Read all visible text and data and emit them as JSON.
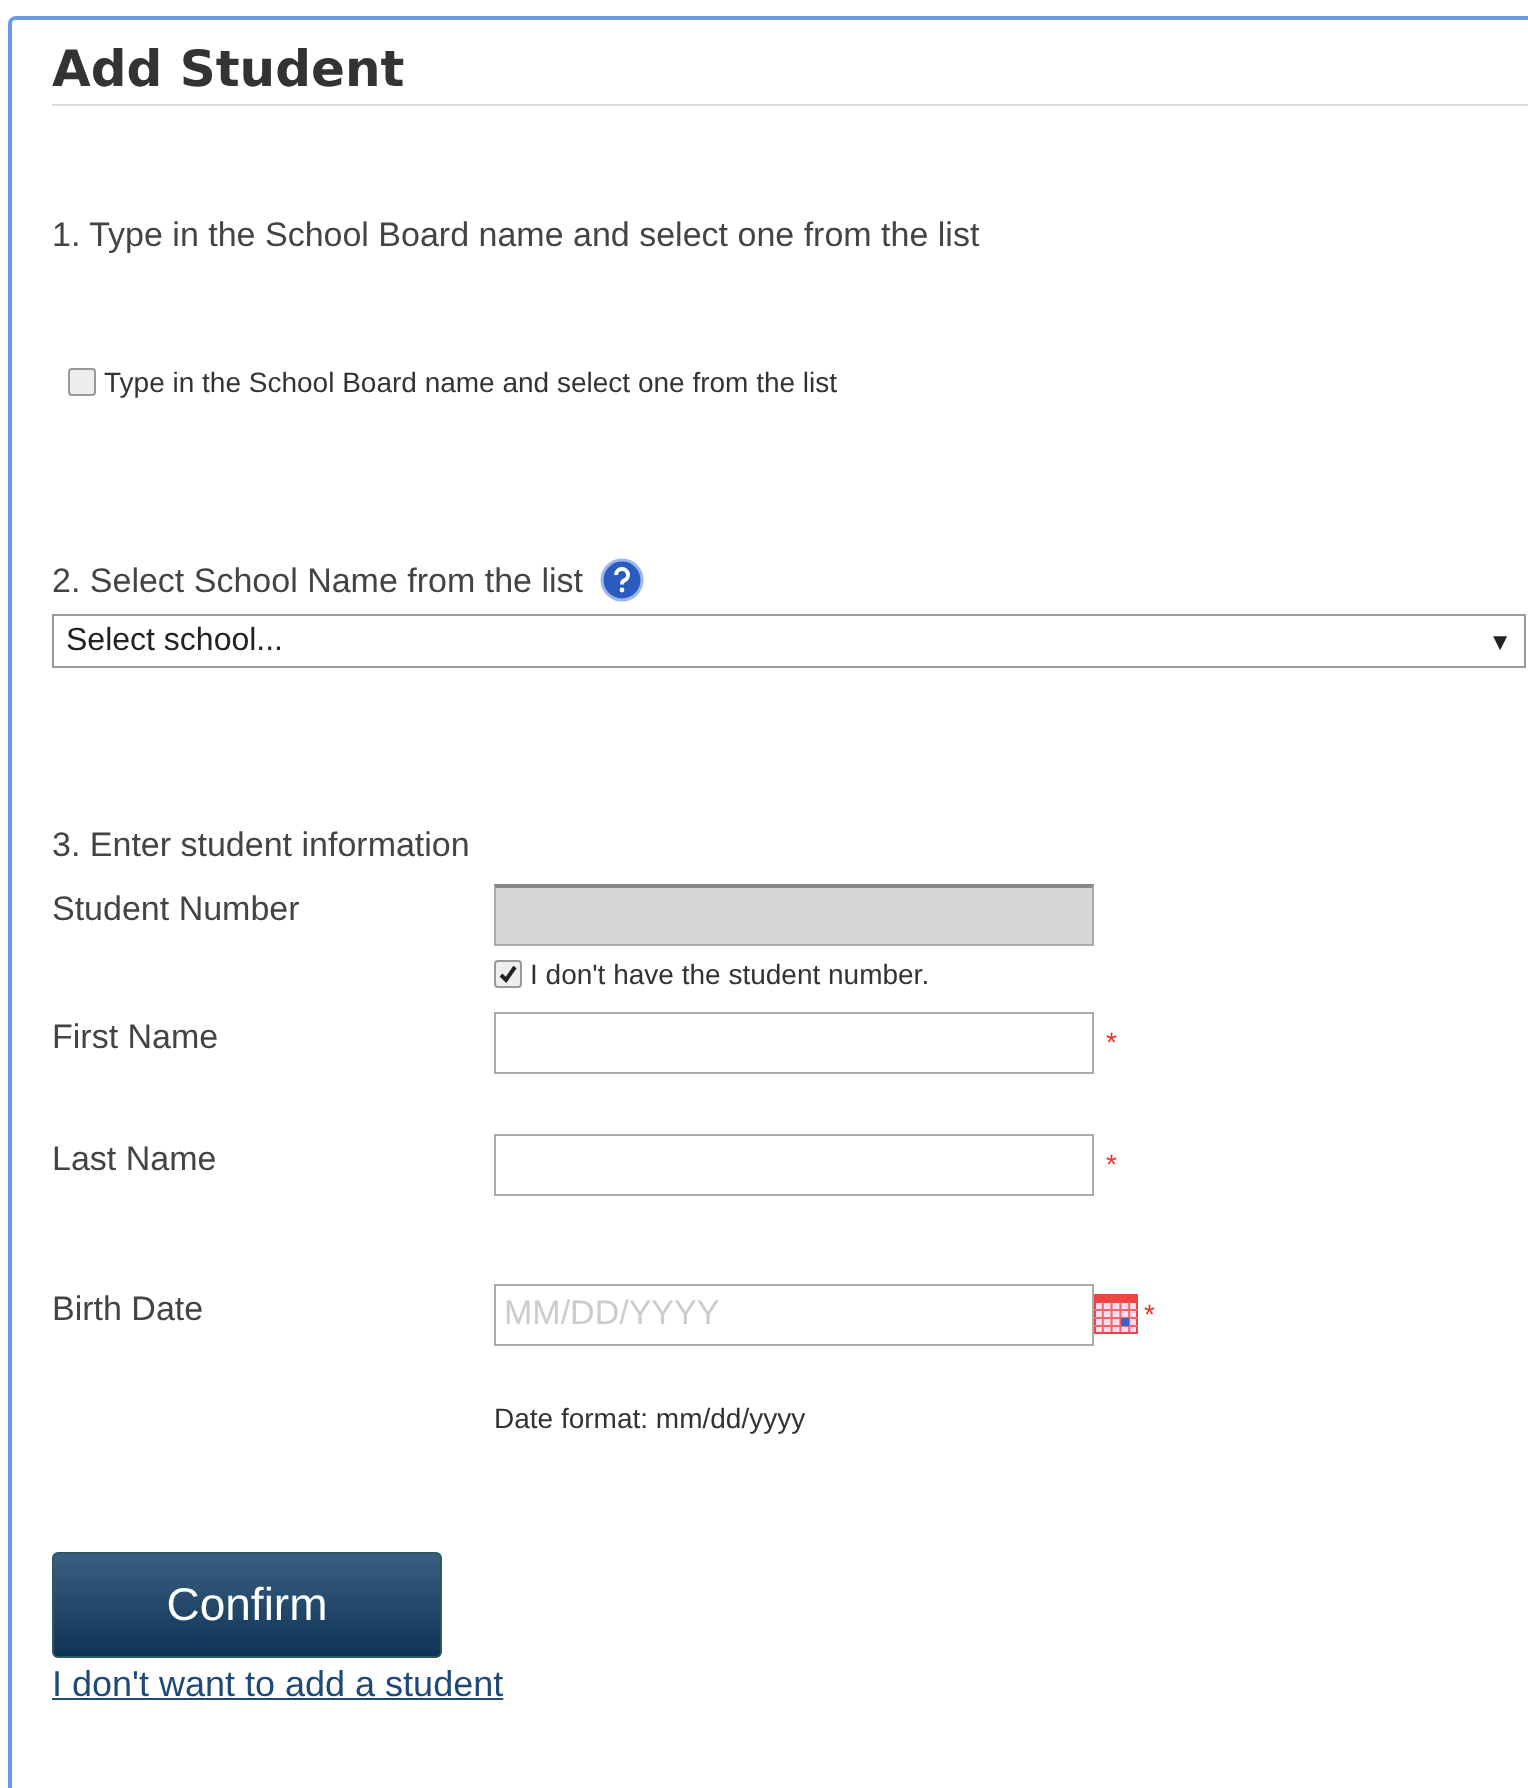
{
  "title": "Add Student",
  "step1": {
    "heading": "1. Type in the School Board name and select one from the list",
    "checkbox": {
      "label": "Type in the School Board name and select one from the list",
      "checked": false
    }
  },
  "step2": {
    "heading": "2. Select School Name from the list",
    "select": {
      "value": "Select school...",
      "arrow": "▼"
    }
  },
  "step3": {
    "heading": "3. Enter student information",
    "required_mark": "*",
    "fields": [
      {
        "kind": "text",
        "label": "Student Number",
        "disabled": true,
        "required": false,
        "checkbox": {
          "label": "I don't have the student number.",
          "checked": true
        }
      },
      {
        "kind": "text",
        "label": "First Name",
        "disabled": false,
        "required": true
      },
      {
        "kind": "text",
        "label": "Last Name",
        "disabled": false,
        "required": true
      },
      {
        "kind": "date",
        "label": "Birth Date",
        "disabled": false,
        "required": true,
        "placeholder": "MM/DD/YYYY",
        "hint": "Date format: mm/dd/yyyy"
      }
    ]
  },
  "confirm": "Confirm",
  "cancel_link": "I don't want to add a student"
}
